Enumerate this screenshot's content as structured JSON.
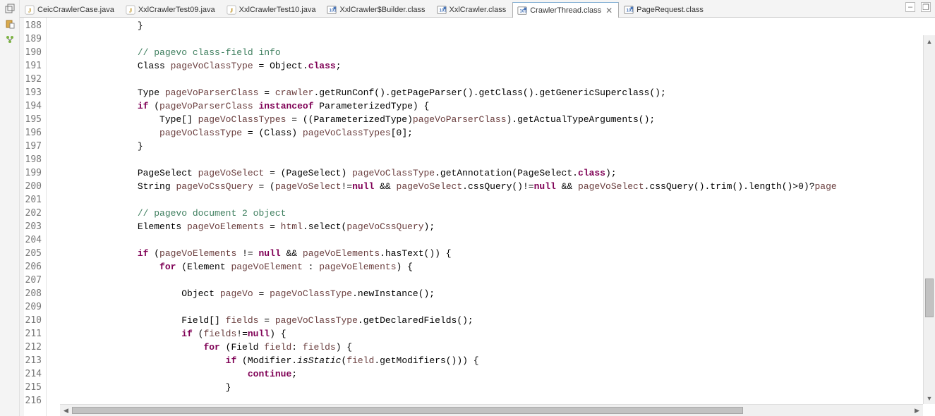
{
  "tabs": [
    {
      "label": "CeicCrawlerCase.java",
      "type": "java",
      "active": false
    },
    {
      "label": "XxlCrawlerTest09.java",
      "type": "java",
      "active": false
    },
    {
      "label": "XxlCrawlerTest10.java",
      "type": "java",
      "active": false
    },
    {
      "label": "XxlCrawler$Builder.class",
      "type": "class",
      "active": false
    },
    {
      "label": "XxlCrawler.class",
      "type": "class",
      "active": false
    },
    {
      "label": "CrawlerThread.class",
      "type": "class",
      "active": true
    },
    {
      "label": "PageRequest.class",
      "type": "class",
      "active": false
    }
  ],
  "toolbar": {
    "restore": "❐",
    "minimize": "–"
  },
  "lines": {
    "start": 188,
    "end": 216
  },
  "code": [
    {
      "n": 188,
      "t": "                }"
    },
    {
      "n": 189,
      "t": ""
    },
    {
      "n": 190,
      "t": "",
      "com": "                // pagevo class-field info"
    },
    {
      "n": 191,
      "t": "                Class <v>pageVoClassType</v> = Object.<kw>class</kw>;"
    },
    {
      "n": 192,
      "t": ""
    },
    {
      "n": 193,
      "t": "                Type <v>pageVoParserClass</v> = <v>crawler</v>.getRunConf().getPageParser().getClass().getGenericSuperclass();"
    },
    {
      "n": 194,
      "t": "                <kw>if</kw> (<v>pageVoParserClass</v> <kw>instanceof</kw> ParameterizedType) {"
    },
    {
      "n": 195,
      "t": "                    Type[] <v>pageVoClassTypes</v> = ((ParameterizedType)<v>pageVoParserClass</v>).getActualTypeArguments();"
    },
    {
      "n": 196,
      "t": "                    <v>pageVoClassType</v> = (Class) <v>pageVoClassTypes</v>[0];"
    },
    {
      "n": 197,
      "t": "                }"
    },
    {
      "n": 198,
      "t": ""
    },
    {
      "n": 199,
      "t": "                PageSelect <v>pageVoSelect</v> = (PageSelect) <v>pageVoClassType</v>.getAnnotation(PageSelect.<kw>class</kw>);"
    },
    {
      "n": 200,
      "t": "                String <v>pageVoCssQuery</v> = (<v>pageVoSelect</v>!=<kw>null</kw> && <v>pageVoSelect</v>.cssQuery()!=<kw>null</kw> && <v>pageVoSelect</v>.cssQuery().trim().length()>0)?<v>page</v>"
    },
    {
      "n": 201,
      "t": ""
    },
    {
      "n": 202,
      "t": "",
      "com": "                // pagevo document 2 object"
    },
    {
      "n": 203,
      "t": "                Elements <v>pageVoElements</v> = <v>html</v>.select(<v>pageVoCssQuery</v>);"
    },
    {
      "n": 204,
      "t": ""
    },
    {
      "n": 205,
      "t": "                <kw>if</kw> (<v>pageVoElements</v> != <kw>null</kw> && <v>pageVoElements</v>.hasText()) {"
    },
    {
      "n": 206,
      "t": "                    <kw>for</kw> (Element <v>pageVoElement</v> : <v>pageVoElements</v>) {"
    },
    {
      "n": 207,
      "t": ""
    },
    {
      "n": 208,
      "t": "                        Object <v>pageVo</v> = <v>pageVoClassType</v>.newInstance();"
    },
    {
      "n": 209,
      "t": ""
    },
    {
      "n": 210,
      "t": "                        Field[] <v>fields</v> = <v>pageVoClassType</v>.getDeclaredFields();"
    },
    {
      "n": 211,
      "t": "                        <kw>if</kw> (<v>fields</v>!=<kw>null</kw>) {"
    },
    {
      "n": 212,
      "t": "                            <kw>for</kw> (Field <v>field</v>: <v>fields</v>) {"
    },
    {
      "n": 213,
      "t": "                                <kw>if</kw> (Modifier.<st>isStatic</st>(<v>field</v>.getModifiers())) {"
    },
    {
      "n": 214,
      "t": "                                    <kw>continue</kw>;"
    },
    {
      "n": 215,
      "t": "                                }"
    },
    {
      "n": 216,
      "t": ""
    }
  ]
}
